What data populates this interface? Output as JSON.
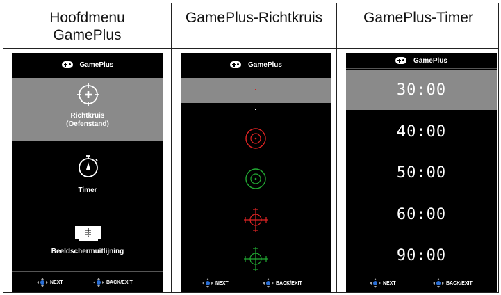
{
  "columns": [
    {
      "header": "Hoofdmenu\nGamePlus"
    },
    {
      "header": "GamePlus-Richtkruis"
    },
    {
      "header": "GamePlus-Timer"
    }
  ],
  "screen_title": "GamePlus",
  "main_menu": {
    "items": [
      {
        "label": "Richtkruis\n(Oefenstand)",
        "icon": "crosshair-icon",
        "selected": true
      },
      {
        "label": "Timer",
        "icon": "stopwatch-icon",
        "selected": false
      },
      {
        "label": "Beeldschermuitlijning",
        "icon": "monitor-alignment-icon",
        "selected": false
      }
    ]
  },
  "crosshair_menu": {
    "options": [
      {
        "style": "dot",
        "color": "#cc2222"
      },
      {
        "style": "dot",
        "color": "#ffffff"
      },
      {
        "style": "circle",
        "color": "#e02424"
      },
      {
        "style": "circle",
        "color": "#22aa33"
      },
      {
        "style": "cross",
        "color": "#e02424"
      },
      {
        "style": "cross",
        "color": "#22aa33"
      }
    ]
  },
  "timer_menu": {
    "values": [
      "30:00",
      "40:00",
      "50:00",
      "60:00",
      "90:00"
    ],
    "selected_index": 0
  },
  "nav": {
    "next_label": "NEXT",
    "back_label": "BACK/EXIT"
  },
  "colors": {
    "selection": "#8a8a8a",
    "nav_icon_blue": "#2a6fd6"
  }
}
